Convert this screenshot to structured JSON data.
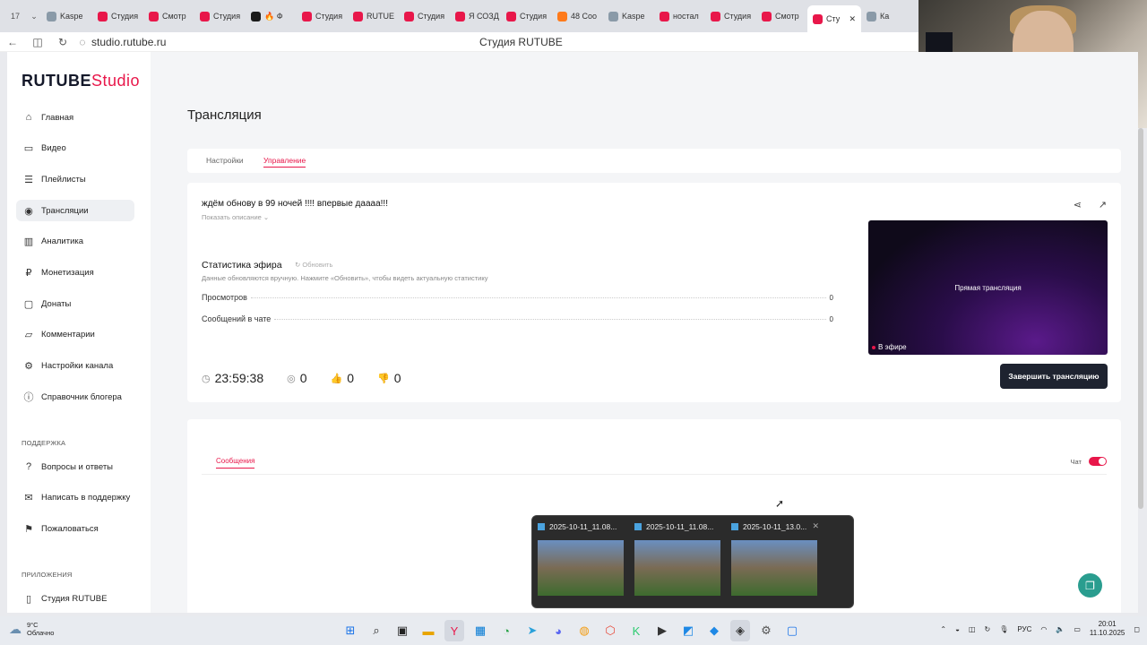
{
  "browser": {
    "tab_count": "17",
    "tabs": [
      {
        "label": "Kaspe",
        "fav": "gray"
      },
      {
        "label": "Студия",
        "fav": "red"
      },
      {
        "label": "Смотр",
        "fav": "red"
      },
      {
        "label": "Студия",
        "fav": "red"
      },
      {
        "label": "🔥 Ф",
        "fav": "dark"
      },
      {
        "label": "Студия",
        "fav": "red"
      },
      {
        "label": "RUTUE",
        "fav": "red"
      },
      {
        "label": "Студия",
        "fav": "red"
      },
      {
        "label": "Я СОЗД",
        "fav": "red"
      },
      {
        "label": "Студия",
        "fav": "red"
      },
      {
        "label": "48 Соо",
        "fav": "orange"
      },
      {
        "label": "Kaspe",
        "fav": "gray"
      },
      {
        "label": "ностал",
        "fav": "red"
      },
      {
        "label": "Студия",
        "fav": "red"
      },
      {
        "label": "Смотр",
        "fav": "red"
      }
    ],
    "active_tab": "Сту",
    "trailing_tab": "Ка",
    "url": "studio.rutube.ru",
    "page_title": "Студия RUTUBE"
  },
  "logo": {
    "brand": "RUTUBE",
    "product": "Studio"
  },
  "sidebar": {
    "items": [
      {
        "label": "Главная",
        "icon": "home-icon",
        "glyph": "⌂"
      },
      {
        "label": "Видео",
        "icon": "video-icon",
        "glyph": "▭"
      },
      {
        "label": "Плейлисты",
        "icon": "playlist-icon",
        "glyph": "☰"
      },
      {
        "label": "Трансляции",
        "icon": "broadcast-icon",
        "glyph": "◉",
        "active": true
      },
      {
        "label": "Аналитика",
        "icon": "analytics-icon",
        "glyph": "▥"
      },
      {
        "label": "Монетизация",
        "icon": "ruble-icon",
        "glyph": "₽"
      },
      {
        "label": "Донаты",
        "icon": "donate-icon",
        "glyph": "▢"
      },
      {
        "label": "Комментарии",
        "icon": "comments-icon",
        "glyph": "▱"
      },
      {
        "label": "Настройки канала",
        "icon": "gear-icon",
        "glyph": "⚙"
      },
      {
        "label": "Справочник блогера",
        "icon": "handbook-icon",
        "glyph": "ⓘ"
      }
    ],
    "support_title": "ПОДДЕРЖКА",
    "support_items": [
      {
        "label": "Вопросы и ответы",
        "icon": "faq-icon",
        "glyph": "?"
      },
      {
        "label": "Написать в поддержку",
        "icon": "mail-icon",
        "glyph": "✉"
      },
      {
        "label": "Пожаловаться",
        "icon": "flag-icon",
        "glyph": "⚑"
      }
    ],
    "apps_title": "ПРИЛОЖЕНИЯ",
    "apps_items": [
      {
        "label": "Студия RUTUBE",
        "icon": "app-icon",
        "glyph": "▯"
      }
    ]
  },
  "main": {
    "title": "Трансляция",
    "tabs": [
      "Настройки",
      "Управление"
    ],
    "active_tab_index": 1,
    "stream": {
      "title": "ждём обнову в 99 ночей !!!! впервые даааа!!!",
      "show_description": "Показать описание ⌄",
      "stats_title": "Статистика эфира",
      "refresh_label": "Обновить",
      "stats_note": "Данные обновляются вручную. Нажмите «Обновить», чтобы видеть актуальную статистику",
      "rows": [
        {
          "label": "Просмотров",
          "value": "0"
        },
        {
          "label": "Сообщений в чате",
          "value": "0"
        }
      ],
      "timer": "23:59:38",
      "viewers": "0",
      "likes": "0",
      "dislikes": "0",
      "preview_label": "Прямая трансляция",
      "live_badge": "В эфире",
      "end_button": "Завершить трансляцию"
    },
    "chat": {
      "tab": "Сообщения",
      "toggle_label": "Чат",
      "toggle_on": true
    }
  },
  "thumbnail_popup": [
    {
      "title": "2025-10-11_11.08..."
    },
    {
      "title": "2025-10-11_11.08..."
    },
    {
      "title": "2025-10-11_13.0..."
    }
  ],
  "taskbar": {
    "temperature": "9°C",
    "weather": "Облачно",
    "language": "РУС",
    "time": "20:01",
    "date": "11.10.2025"
  },
  "colors": {
    "accent": "#e8174a",
    "dark_button": "#1e2330",
    "support": "#2a9d8f"
  }
}
